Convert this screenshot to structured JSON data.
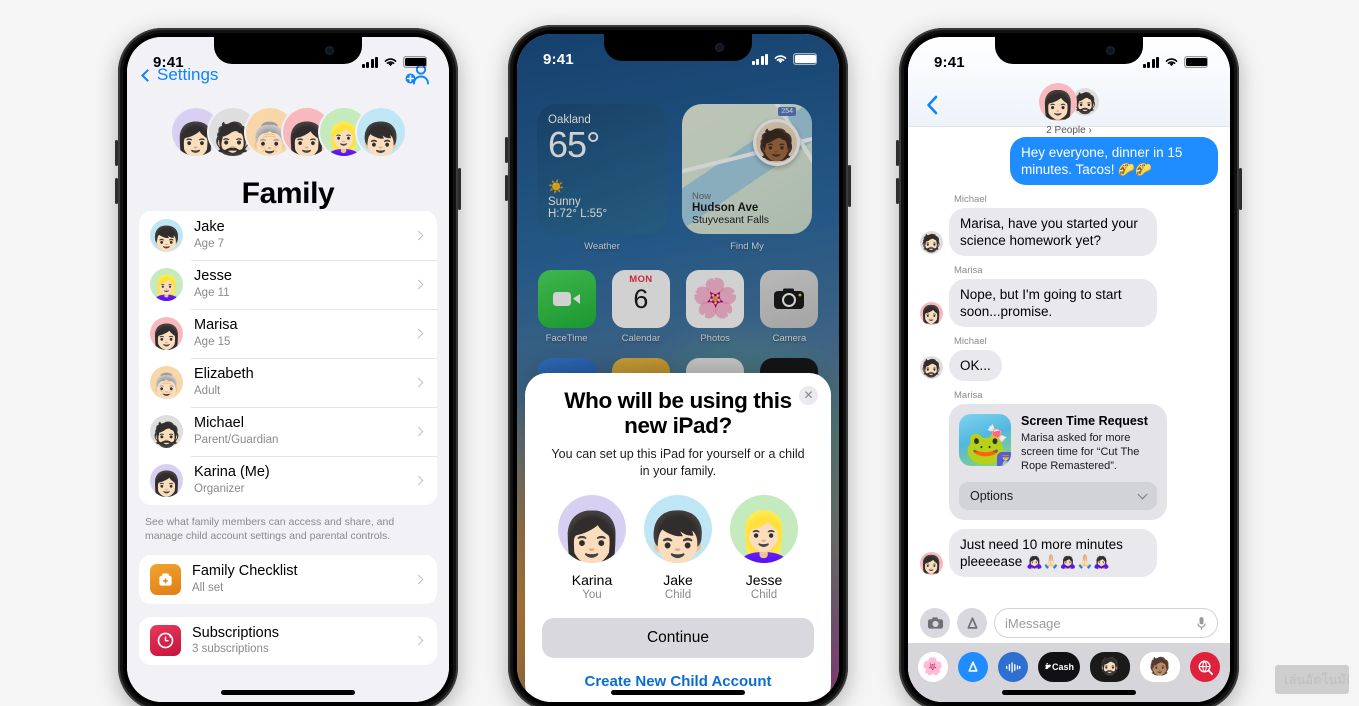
{
  "background_color": "#f5f5f5",
  "watermark": {
    "text": "เล่นอัตโนมัติ"
  },
  "phone1": {
    "status": {
      "time": "9:41"
    },
    "nav": {
      "back_label": "Settings",
      "add_person_icon": "add-person-icon"
    },
    "hero": {
      "title": "Family",
      "memoji": [
        {
          "name": "Karina",
          "bg": "#d8d0f2",
          "glyph": "👩🏻"
        },
        {
          "name": "Michael",
          "bg": "#dedede",
          "glyph": "🧔🏻"
        },
        {
          "name": "Elizabeth",
          "bg": "#f7d7a8",
          "glyph": "👵🏻"
        },
        {
          "name": "Marisa",
          "bg": "#f7b9bd",
          "glyph": "👩🏻"
        },
        {
          "name": "Jesse",
          "bg": "#c4eabd",
          "glyph": "👱🏻‍♀️"
        },
        {
          "name": "Jake",
          "bg": "#bfe6f5",
          "glyph": "👦🏻"
        }
      ]
    },
    "members": [
      {
        "name": "Jake",
        "role": "Age 7",
        "bg": "#bfe6f5",
        "glyph": "👦🏻"
      },
      {
        "name": "Jesse",
        "role": "Age 11",
        "bg": "#c4eabd",
        "glyph": "👱🏻‍♀️"
      },
      {
        "name": "Marisa",
        "role": "Age 15",
        "bg": "#f7b9bd",
        "glyph": "👩🏻"
      },
      {
        "name": "Elizabeth",
        "role": "Adult",
        "bg": "#f7d7a8",
        "glyph": "👵🏻"
      },
      {
        "name": "Michael",
        "role": "Parent/Guardian",
        "bg": "#dedede",
        "glyph": "🧔🏻"
      },
      {
        "name": "Karina (Me)",
        "role": "Organizer",
        "bg": "#d8d0f2",
        "glyph": "👩🏻"
      }
    ],
    "footer_note": "See what family members can access and share, and manage child account settings and parental controls.",
    "checklist": {
      "title": "Family Checklist",
      "sub": "All set",
      "icon": "checklist-icon",
      "color": "#ed9121"
    },
    "subscriptions": {
      "title": "Subscriptions",
      "sub": "3 subscriptions",
      "icon": "subscriptions-icon",
      "color": "#d62b4e"
    }
  },
  "phone2": {
    "status": {
      "time": "9:41"
    },
    "weather_widget": {
      "city": "Oakland",
      "temp": "65°",
      "condition": "Sunny",
      "highlow": "H:72° L:55°",
      "label": "Weather",
      "sun_icon": "sun-icon"
    },
    "findmy_widget": {
      "when": "Now",
      "place": "Hudson Ave",
      "area": "Stuyvesant Falls",
      "label": "Find My",
      "road_badge": "254",
      "avatar_glyph": "🧑🏾"
    },
    "apps_row1": [
      {
        "name": "FaceTime",
        "icon": "facetime-icon",
        "glyph": "📹",
        "bg": "#3ec13e"
      },
      {
        "name": "Calendar",
        "icon": "calendar-icon",
        "glyph": "",
        "bg": "#ffffff",
        "day": "MON",
        "date": "6"
      },
      {
        "name": "Photos",
        "icon": "photos-icon",
        "glyph": "🌸",
        "bg": "#ffffff"
      },
      {
        "name": "Camera",
        "icon": "camera-icon",
        "glyph": "📷",
        "bg": "#d6d6d6"
      }
    ],
    "apps_row2": [
      {
        "name": "",
        "icon": "app-blue-icon",
        "glyph": "",
        "bg": "#2f6fd0"
      },
      {
        "name": "",
        "icon": "app-yellow-icon",
        "glyph": "",
        "bg": "#e8b130"
      },
      {
        "name": "",
        "icon": "app-white-icon",
        "glyph": "",
        "bg": "#f0f0f0"
      },
      {
        "name": "",
        "icon": "app-dark-icon",
        "glyph": "",
        "bg": "#1d1d1f"
      }
    ],
    "modal": {
      "close_icon": "close-icon",
      "heading": "Who will be using this new iPad?",
      "body": "You can set up this iPad for yourself or a child in your family.",
      "choices": [
        {
          "name": "Karina",
          "role": "You",
          "bg": "#d8d0f2",
          "glyph": "👩🏻"
        },
        {
          "name": "Jake",
          "role": "Child",
          "bg": "#bfe6f5",
          "glyph": "👦🏻"
        },
        {
          "name": "Jesse",
          "role": "Child",
          "bg": "#c4eabd",
          "glyph": "👱🏻‍♀️"
        }
      ],
      "continue_label": "Continue",
      "create_label": "Create New Child Account"
    }
  },
  "phone3": {
    "status": {
      "time": "9:41"
    },
    "nav": {
      "back_icon": "back-chevron-icon",
      "people_label": "2 People",
      "avatar1_glyph": "👩🏻",
      "avatar1_bg": "#f7b9bd",
      "avatar2_glyph": "🧔🏻",
      "avatar2_bg": "#dedede"
    },
    "messages": [
      {
        "side": "out",
        "text": "Hey everyone, dinner in 15 minutes. Tacos! 🌮🌮"
      },
      {
        "side": "in",
        "sender": "Michael",
        "text": "Marisa, have you started your science homework yet?",
        "bg": "#dedede",
        "glyph": "🧔🏻"
      },
      {
        "side": "in",
        "sender": "Marisa",
        "text": "Nope, but I'm going to start soon...promise.",
        "bg": "#f7b9bd",
        "glyph": "👩🏻"
      },
      {
        "side": "in",
        "sender": "Michael",
        "text": "OK...",
        "bg": "#dedede",
        "glyph": "🧔🏻"
      }
    ],
    "screen_time_card": {
      "sender": "Marisa",
      "title": "Screen Time Request",
      "body": "Marisa asked for more screen time for “Cut The Rope Remastered”.",
      "options_label": "Options",
      "app_icon": "cut-the-rope-icon",
      "hourglass_icon": "hourglass-icon"
    },
    "last_message": {
      "text": "Just need 10 more minutes pleeeease 🙇🏻‍♀️🙏🏻🙇🏻‍♀️🙏🏻🙇🏻‍♀️",
      "bg": "#f7b9bd",
      "glyph": "👩🏻"
    },
    "composer": {
      "camera_icon": "camera-icon",
      "appstore_icon": "app-store-icon",
      "placeholder": "iMessage",
      "mic_icon": "microphone-icon"
    },
    "app_drawer": [
      {
        "icon": "photos-icon",
        "glyph": "🌸",
        "bg": "#ffffff"
      },
      {
        "icon": "app-store-icon",
        "glyph": "A",
        "bg": "#1f8cff"
      },
      {
        "icon": "voice-memo-icon",
        "glyph": "〰",
        "bg": "#2f6fd0"
      },
      {
        "icon": "apple-cash-icon",
        "glyph": "Cash",
        "bg": "#111114"
      },
      {
        "icon": "memoji-sticker-icon",
        "glyph": "🧔🏻",
        "bg": "#1a1a1a"
      },
      {
        "icon": "animoji-icon",
        "glyph": "🧑🏽",
        "bg": "#ffffff"
      },
      {
        "icon": "image-search-icon",
        "glyph": "🔎",
        "bg": "#e0213c"
      }
    ]
  }
}
